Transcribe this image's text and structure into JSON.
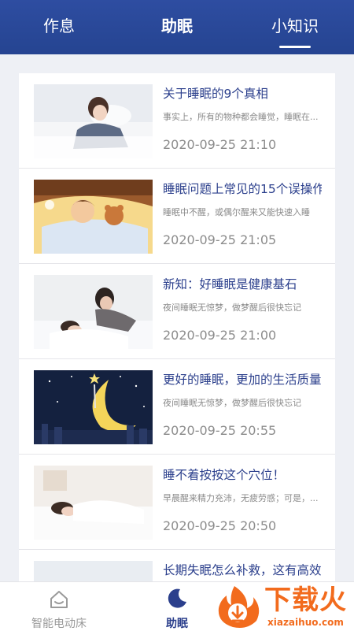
{
  "header": {
    "tabs": [
      {
        "label": "作息",
        "active": false
      },
      {
        "label": "助眠",
        "active": false
      },
      {
        "label": "小知识",
        "active": true
      }
    ]
  },
  "articles": [
    {
      "title": "关于睡眠的9个真相",
      "summary": "事实上，所有的物种都会睡觉，睡眠在...",
      "date": "2020-09-25 21:10",
      "image": "girl-sleeping-photo"
    },
    {
      "title": "睡眠问题上常见的15个误操作",
      "summary": "睡眠中不醒，或偶尔醒来又能快速入睡",
      "date": "2020-09-25 21:05",
      "image": "cartoon-child-teddy-bear"
    },
    {
      "title": "新知：好睡眠是健康基石",
      "summary": "夜间睡眠无惊梦，做梦醒后很快忘记",
      "date": "2020-09-25 21:00",
      "image": "mother-child-bed-photo"
    },
    {
      "title": "更好的睡眠，更加的生活质量",
      "summary": "夜间睡眠无惊梦，做梦醒后很快忘记",
      "date": "2020-09-25 20:55",
      "image": "moon-night-city-illustration"
    },
    {
      "title": "睡不着按按这个穴位！",
      "summary": "早晨醒来精力充沛，无疲劳感；可是，...",
      "date": "2020-09-25 20:50",
      "image": "woman-sleeping-photo"
    },
    {
      "title": "长期失眠怎么补救，这有高效方法",
      "summary": "",
      "date": "",
      "image": "bedroom-photo"
    }
  ],
  "bottom_nav": {
    "items": [
      {
        "label": "智能电动床",
        "icon": "home-icon",
        "active": false
      },
      {
        "label": "助眠",
        "icon": "moon-icon",
        "active": true
      }
    ]
  },
  "watermark": {
    "brand": "下载火",
    "url": "xiazaihuo.com"
  },
  "colors": {
    "header_bg": "#2e4da1",
    "title_text": "#2b3f8c",
    "active_nav": "#2b3f8c",
    "watermark_orange": "#f26b1d"
  }
}
